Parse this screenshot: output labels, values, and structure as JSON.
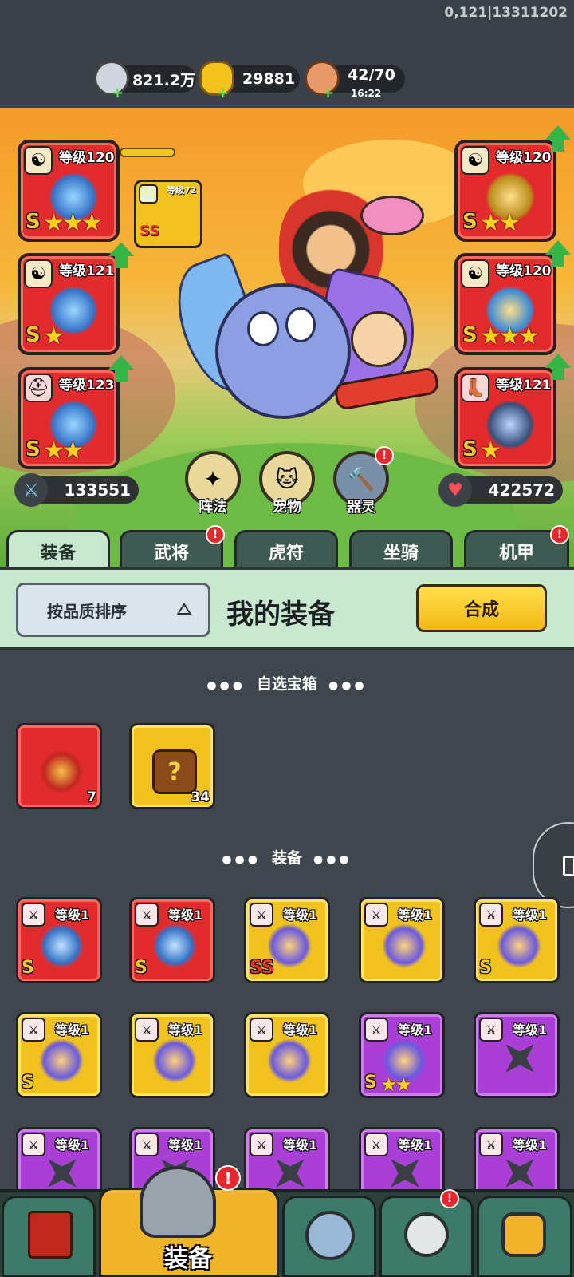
{
  "debug_text": "0,121|13311202",
  "resources": [
    {
      "name": "silver-coin",
      "value": "821.2万",
      "sub": ""
    },
    {
      "name": "gold-ingot",
      "value": "29881",
      "sub": ""
    },
    {
      "name": "meat-stamina",
      "value": "42/70",
      "sub": "16:22"
    }
  ],
  "slots_left": [
    {
      "level": "等级120",
      "grade": "S",
      "stars": "★★★",
      "badge": "yin-yang-icon"
    },
    {
      "level": "等级121",
      "grade": "S",
      "stars": "★",
      "badge": "yin-yang-icon"
    },
    {
      "level": "等级123",
      "grade": "S",
      "stars": "★★",
      "badge": "helmet-icon"
    }
  ],
  "slots_right": [
    {
      "level": "等级120",
      "grade": "S",
      "stars": "★★",
      "badge": "yin-yang-icon"
    },
    {
      "level": "等级120",
      "grade": "S",
      "stars": "★★★",
      "badge": "yin-yang-icon"
    },
    {
      "level": "等级121",
      "grade": "S",
      "stars": "★",
      "badge": "boot-icon"
    }
  ],
  "small_slot": {
    "level": "等级72",
    "grade": "SS"
  },
  "attack": "133551",
  "hp": "422572",
  "round_buttons": [
    {
      "label": "阵法"
    },
    {
      "label": "宠物"
    },
    {
      "label": "器灵"
    }
  ],
  "tabs": [
    "装备",
    "武将",
    "虎符",
    "坐骑",
    "机甲"
  ],
  "sort_label": "按品质排序",
  "my_equipment": "我的装备",
  "merge_label": "合成",
  "section_chest": "自选宝箱",
  "section_equipment": "装备",
  "chests": [
    {
      "count": "7",
      "color": "red"
    },
    {
      "count": "34",
      "color": "gold"
    }
  ],
  "items": [
    {
      "level": "等级1",
      "color": "red",
      "grade": "S",
      "stars": ""
    },
    {
      "level": "等级1",
      "color": "red",
      "grade": "S",
      "stars": ""
    },
    {
      "level": "等级1",
      "color": "gold",
      "grade": "SS",
      "stars": ""
    },
    {
      "level": "等级1",
      "color": "gold",
      "grade": "",
      "stars": ""
    },
    {
      "level": "等级1",
      "color": "gold",
      "grade": "S",
      "stars": ""
    },
    {
      "level": "等级1",
      "color": "gold",
      "grade": "S",
      "stars": ""
    },
    {
      "level": "等级1",
      "color": "gold",
      "grade": "",
      "stars": ""
    },
    {
      "level": "等级1",
      "color": "gold",
      "grade": "",
      "stars": ""
    },
    {
      "level": "等级1",
      "color": "purple",
      "grade": "S",
      "stars": "★★"
    },
    {
      "level": "等级1",
      "color": "purple",
      "grade": "",
      "stars": ""
    },
    {
      "level": "等级1",
      "color": "purple",
      "grade": "",
      "stars": ""
    },
    {
      "level": "等级1",
      "color": "purple",
      "grade": "",
      "stars": ""
    },
    {
      "level": "等级1",
      "color": "purple",
      "grade": "",
      "stars": ""
    },
    {
      "level": "等级1",
      "color": "purple",
      "grade": "",
      "stars": ""
    },
    {
      "level": "等级1",
      "color": "purple",
      "grade": "",
      "stars": ""
    }
  ],
  "nav": [
    {
      "name": "shop"
    },
    {
      "name": "equipment",
      "label": "装备"
    },
    {
      "name": "battle"
    },
    {
      "name": "gacha"
    },
    {
      "name": "growth"
    }
  ],
  "alert_mark": "!",
  "plus_mark": "+"
}
